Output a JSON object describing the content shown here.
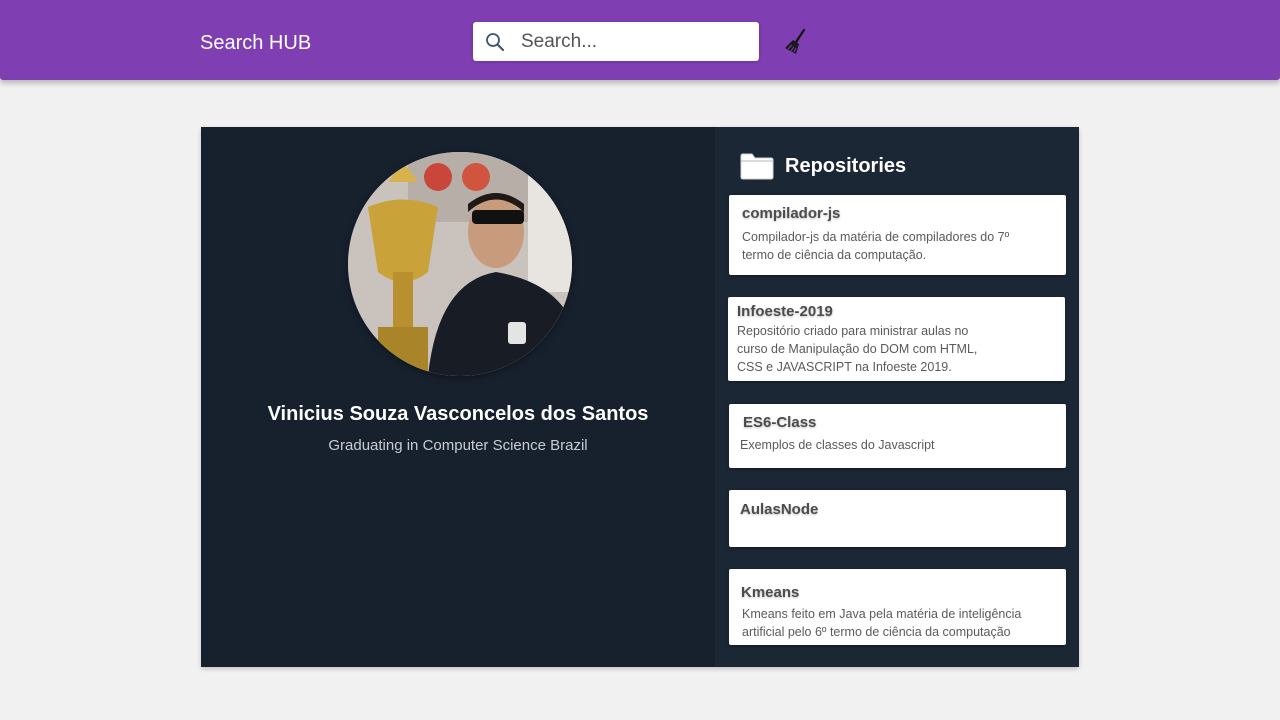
{
  "header": {
    "brand": "Search HUB",
    "search_placeholder": "Search...",
    "search_value": "",
    "accent_color": "#7f3eb1"
  },
  "profile": {
    "name": "Vinicius Souza Vasconcelos dos Santos",
    "bio": "Graduating in Computer Science Brazil",
    "avatar_icon": "profile-photo"
  },
  "repositories": {
    "title": "Repositories",
    "icon": "folder-icon",
    "items": [
      {
        "name": "compilador-js",
        "description": "Compilador-js da matéria de compiladores do 7º\ntermo de ciência da computação."
      },
      {
        "name": "Infoeste-2019",
        "description": "Repositório criado para ministrar aulas no\n curso de Manipulação do DOM com HTML,\nCSS e JAVASCRIPT na Infoeste 2019."
      },
      {
        "name": "ES6-Class",
        "description": "Exemplos de classes do Javascript"
      },
      {
        "name": "AulasNode",
        "description": ""
      },
      {
        "name": "Kmeans",
        "description": "Kmeans feito em Java pela matéria de inteligência\n artificial pelo 6º termo de ciência da computação"
      }
    ]
  }
}
